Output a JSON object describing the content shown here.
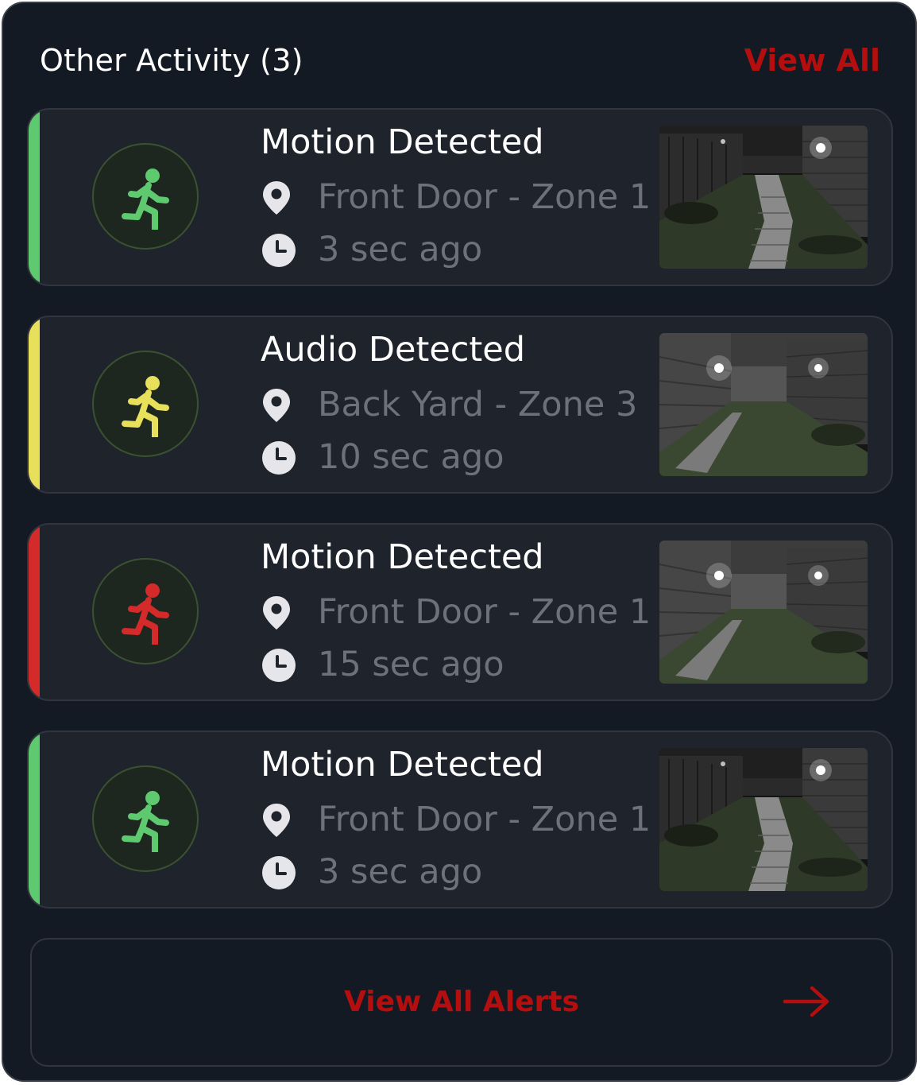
{
  "colors": {
    "accent": "#b50e0e",
    "green": "#5ec96f",
    "yellow": "#e8e05a",
    "red": "#d52a2a"
  },
  "header": {
    "title": "Other Activity (3)",
    "view_all_label": "View All"
  },
  "alerts": [
    {
      "title": "Motion Detected",
      "location": "Front Door - Zone 1",
      "time": "3 sec ago",
      "severity_color": "#5ec96f",
      "icon": "running-person-icon",
      "thumbnail": "front-door-camera-thumbnail"
    },
    {
      "title": "Audio Detected",
      "location": "Back Yard - Zone 3",
      "time": "10 sec ago",
      "severity_color": "#e8e05a",
      "icon": "running-person-icon",
      "thumbnail": "back-yard-camera-thumbnail"
    },
    {
      "title": "Motion Detected",
      "location": "Front Door - Zone 1",
      "time": "15 sec ago",
      "severity_color": "#d52a2a",
      "icon": "running-person-icon",
      "thumbnail": "back-yard-camera-thumbnail"
    },
    {
      "title": "Motion Detected",
      "location": "Front Door - Zone 1",
      "time": "3 sec ago",
      "severity_color": "#5ec96f",
      "icon": "running-person-icon",
      "thumbnail": "front-door-camera-thumbnail"
    }
  ],
  "footer": {
    "label": "View All Alerts",
    "icon": "arrow-right-icon"
  }
}
